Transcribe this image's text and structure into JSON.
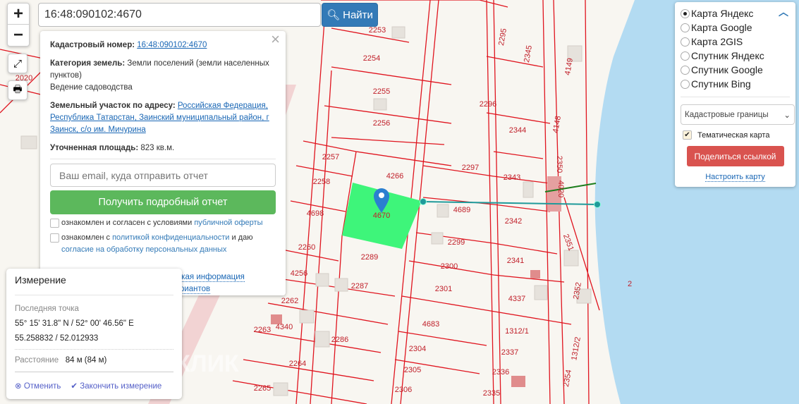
{
  "search": {
    "value": "16:48:090102:4670",
    "button": "Найти",
    "icon": "search-icon"
  },
  "zoom": {
    "in": "+",
    "out": "−"
  },
  "info": {
    "cad_label": "Кадастровый номер:",
    "cad_value": "16:48:090102:4670",
    "cat_label": "Категория земель:",
    "cat_value": "Земли поселений (земли населенных пунктов)",
    "use": "Ведение садоводства",
    "addr_label": "Земельный участок по адресу:",
    "addr_value": "Российская Федерация, Республика Татарстан, Заинский муниципальный район, г Заинск, с/о им. Мичурина",
    "area_label": "Уточненная площадь:",
    "area_value": "823 кв.м.",
    "email_placeholder": "Ваш email, куда отправить отчет",
    "get_report": "Получить подробный отчет",
    "agree1_text": "ознакомлен и согласен с условиями ",
    "agree1_link": "публичной оферты",
    "agree2_text": "ознакомлен с ",
    "agree2_link": "политикой конфиденциальности",
    "agree2_mid": " и даю ",
    "agree2_link2": "согласие на обработку персональных данных",
    "details_link": "Детали отчета и юридическая информация",
    "manual_link": "Ручной выбор вариантов"
  },
  "measure": {
    "title": "Измерение",
    "last_point_label": "Последняя точка",
    "dms": "55° 15' 31.8\" N / 52° 00' 46.56\" E",
    "decimal": "55.258832 / 52.012933",
    "distance_label": "Расстояние",
    "distance_value": "84 м (84 м)",
    "cancel": "Отменить",
    "finish": "Закончить измерение"
  },
  "layers": {
    "options": [
      "Карта Яндекс",
      "Карта Google",
      "Карта 2GIS",
      "Спутник Яндекс",
      "Спутник Google",
      "Спутник Bing"
    ],
    "selected": "Карта Яндекс",
    "overlay": "Кадастровые границы",
    "thematic": "Тематическая карта",
    "thematic_checked": true,
    "share": "Поделиться ссылкой",
    "configure": "Настроить карту"
  },
  "map": {
    "parcels": [
      "2253",
      "2254",
      "2255",
      "2256",
      "2257",
      "2258",
      "4698",
      "4266",
      "4670",
      "2289",
      "2260",
      "4256",
      "2287",
      "2262",
      "2263",
      "4340",
      "2286",
      "2264",
      "2265",
      "2304",
      "2305",
      "2306",
      "4683",
      "2301",
      "2300",
      "2299",
      "4689",
      "2297",
      "2296",
      "2295",
      "2345",
      "2344",
      "2343",
      "2342",
      "2341",
      "4337",
      "1312/1",
      "2337",
      "2336",
      "2335",
      "4149",
      "4148",
      "2350",
      "4020",
      "2351",
      "2352",
      "1312/2",
      "2354",
      "2",
      "2020"
    ],
    "watermark": "ДОМКЛИК",
    "colors": {
      "parcel_line": "#e0141e",
      "selected": "#3ef57a",
      "water": "#b3dbf2",
      "measure_line": "#1f9a9a",
      "marker": "#2b7fd0"
    }
  }
}
